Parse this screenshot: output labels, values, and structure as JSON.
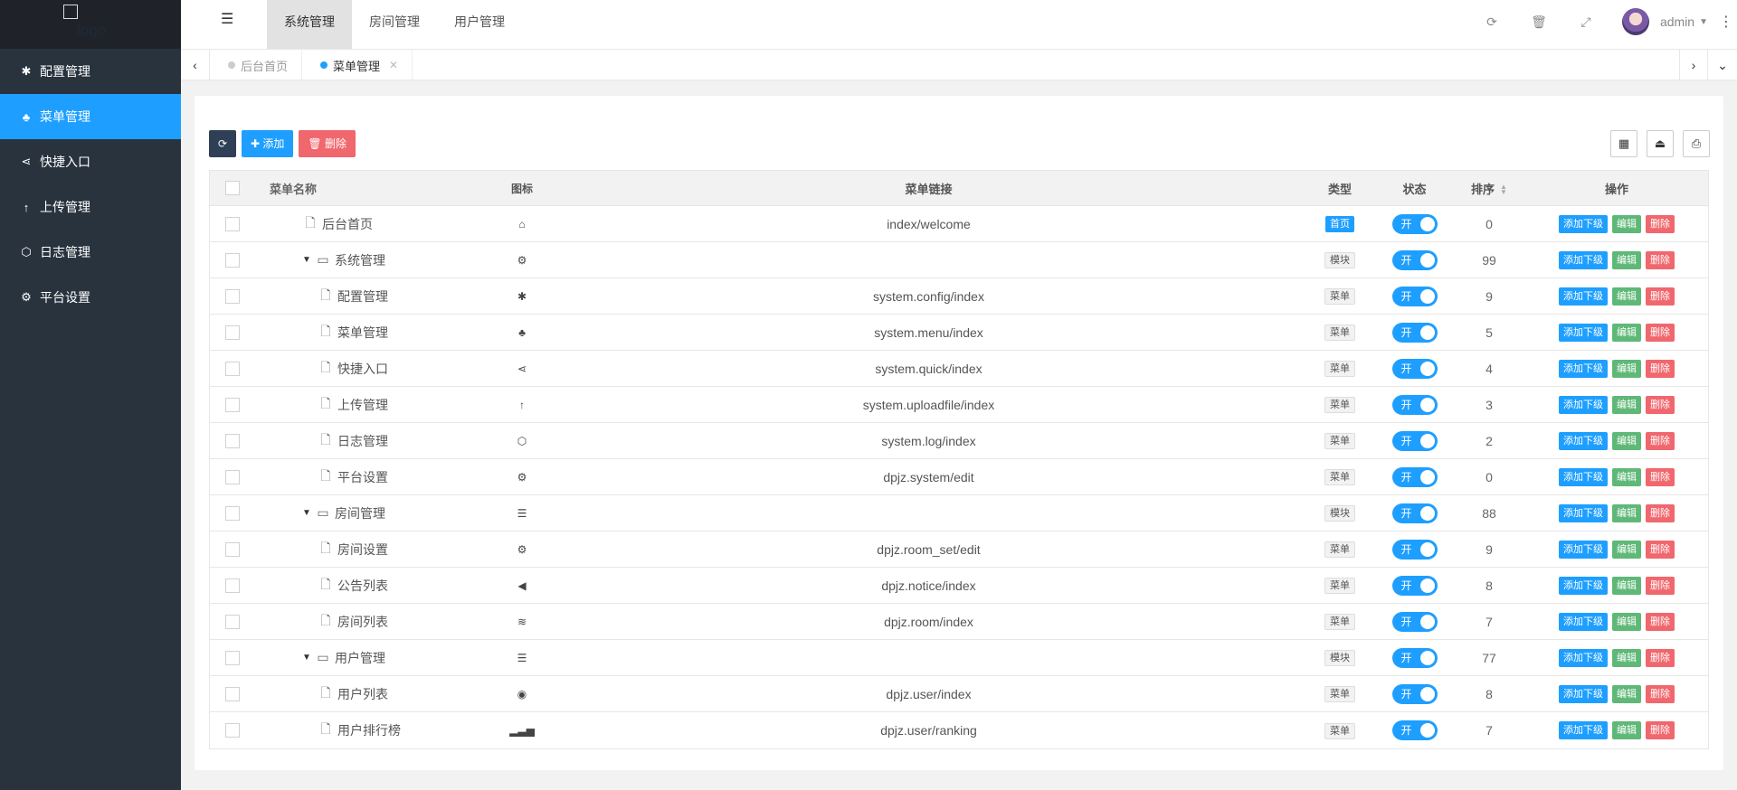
{
  "sidebar": {
    "logo_text": "logo",
    "items": [
      {
        "label": "配置管理",
        "icon": "asterisk-icon",
        "glyph": "✱",
        "active": false
      },
      {
        "label": "菜单管理",
        "icon": "tree-icon",
        "glyph": "♣",
        "active": true
      },
      {
        "label": "快捷入口",
        "icon": "share-icon",
        "glyph": "⋖",
        "active": false
      },
      {
        "label": "上传管理",
        "icon": "arrow-up-icon",
        "glyph": "↑",
        "active": false
      },
      {
        "label": "日志管理",
        "icon": "log-icon",
        "glyph": "⬡",
        "active": false
      },
      {
        "label": "平台设置",
        "icon": "gears-icon",
        "glyph": "⚙",
        "active": false
      }
    ]
  },
  "header": {
    "top_nav": [
      "系统管理",
      "房间管理",
      "用户管理"
    ],
    "active_nav": 0,
    "username": "admin"
  },
  "tabs": [
    {
      "label": "后台首页",
      "active": false
    },
    {
      "label": "菜单管理",
      "active": true
    }
  ],
  "toolbar": {
    "add_label": "添加",
    "delete_label": "删除"
  },
  "table": {
    "headers": {
      "name": "菜单名称",
      "icon": "图标",
      "link": "菜单链接",
      "type": "类型",
      "status": "状态",
      "sort": "排序",
      "ops": "操作"
    },
    "ops": {
      "add_child": "添加下级",
      "edit": "编辑",
      "delete": "删除"
    },
    "switch_on": "开",
    "rows": [
      {
        "name": "后台首页",
        "level": 0,
        "folder": false,
        "icon": "home-icon",
        "glyph": "⌂",
        "link": "index/welcome",
        "type": "首页",
        "type_kind": "home",
        "sort": "0"
      },
      {
        "name": "系统管理",
        "level": 0,
        "folder": true,
        "icon": "gear-icon",
        "glyph": "⚙",
        "link": "",
        "type": "模块",
        "type_kind": "mod",
        "sort": "99"
      },
      {
        "name": "配置管理",
        "level": 1,
        "folder": false,
        "icon": "asterisk-icon",
        "glyph": "✱",
        "link": "system.config/index",
        "type": "菜单",
        "type_kind": "menu",
        "sort": "9"
      },
      {
        "name": "菜单管理",
        "level": 1,
        "folder": false,
        "icon": "tree-icon",
        "glyph": "♣",
        "link": "system.menu/index",
        "type": "菜单",
        "type_kind": "menu",
        "sort": "5"
      },
      {
        "name": "快捷入口",
        "level": 1,
        "folder": false,
        "icon": "share-icon",
        "glyph": "⋖",
        "link": "system.quick/index",
        "type": "菜单",
        "type_kind": "menu",
        "sort": "4"
      },
      {
        "name": "上传管理",
        "level": 1,
        "folder": false,
        "icon": "arrow-up-icon",
        "glyph": "↑",
        "link": "system.uploadfile/index",
        "type": "菜单",
        "type_kind": "menu",
        "sort": "3"
      },
      {
        "name": "日志管理",
        "level": 1,
        "folder": false,
        "icon": "log-icon",
        "glyph": "⬡",
        "link": "system.log/index",
        "type": "菜单",
        "type_kind": "menu",
        "sort": "2"
      },
      {
        "name": "平台设置",
        "level": 1,
        "folder": false,
        "icon": "gears-icon",
        "glyph": "⚙",
        "link": "dpjz.system/edit",
        "type": "菜单",
        "type_kind": "menu",
        "sort": "0"
      },
      {
        "name": "房间管理",
        "level": 0,
        "folder": true,
        "icon": "list-icon",
        "glyph": "☰",
        "link": "",
        "type": "模块",
        "type_kind": "mod",
        "sort": "88"
      },
      {
        "name": "房间设置",
        "level": 1,
        "folder": false,
        "icon": "gear-icon",
        "glyph": "⚙",
        "link": "dpjz.room_set/edit",
        "type": "菜单",
        "type_kind": "menu",
        "sort": "9"
      },
      {
        "name": "公告列表",
        "level": 1,
        "folder": false,
        "icon": "bullhorn-icon",
        "glyph": "◀",
        "link": "dpjz.notice/index",
        "type": "菜单",
        "type_kind": "menu",
        "sort": "8"
      },
      {
        "name": "房间列表",
        "level": 1,
        "folder": false,
        "icon": "database-icon",
        "glyph": "≋",
        "link": "dpjz.room/index",
        "type": "菜单",
        "type_kind": "menu",
        "sort": "7"
      },
      {
        "name": "用户管理",
        "level": 0,
        "folder": true,
        "icon": "list-icon",
        "glyph": "☰",
        "link": "",
        "type": "模块",
        "type_kind": "mod",
        "sort": "77"
      },
      {
        "name": "用户列表",
        "level": 1,
        "folder": false,
        "icon": "user-circle-icon",
        "glyph": "◉",
        "link": "dpjz.user/index",
        "type": "菜单",
        "type_kind": "menu",
        "sort": "8"
      },
      {
        "name": "用户排行榜",
        "level": 1,
        "folder": false,
        "icon": "signal-icon",
        "glyph": "▂▃▅",
        "link": "dpjz.user/ranking",
        "type": "菜单",
        "type_kind": "menu",
        "sort": "7"
      }
    ]
  }
}
